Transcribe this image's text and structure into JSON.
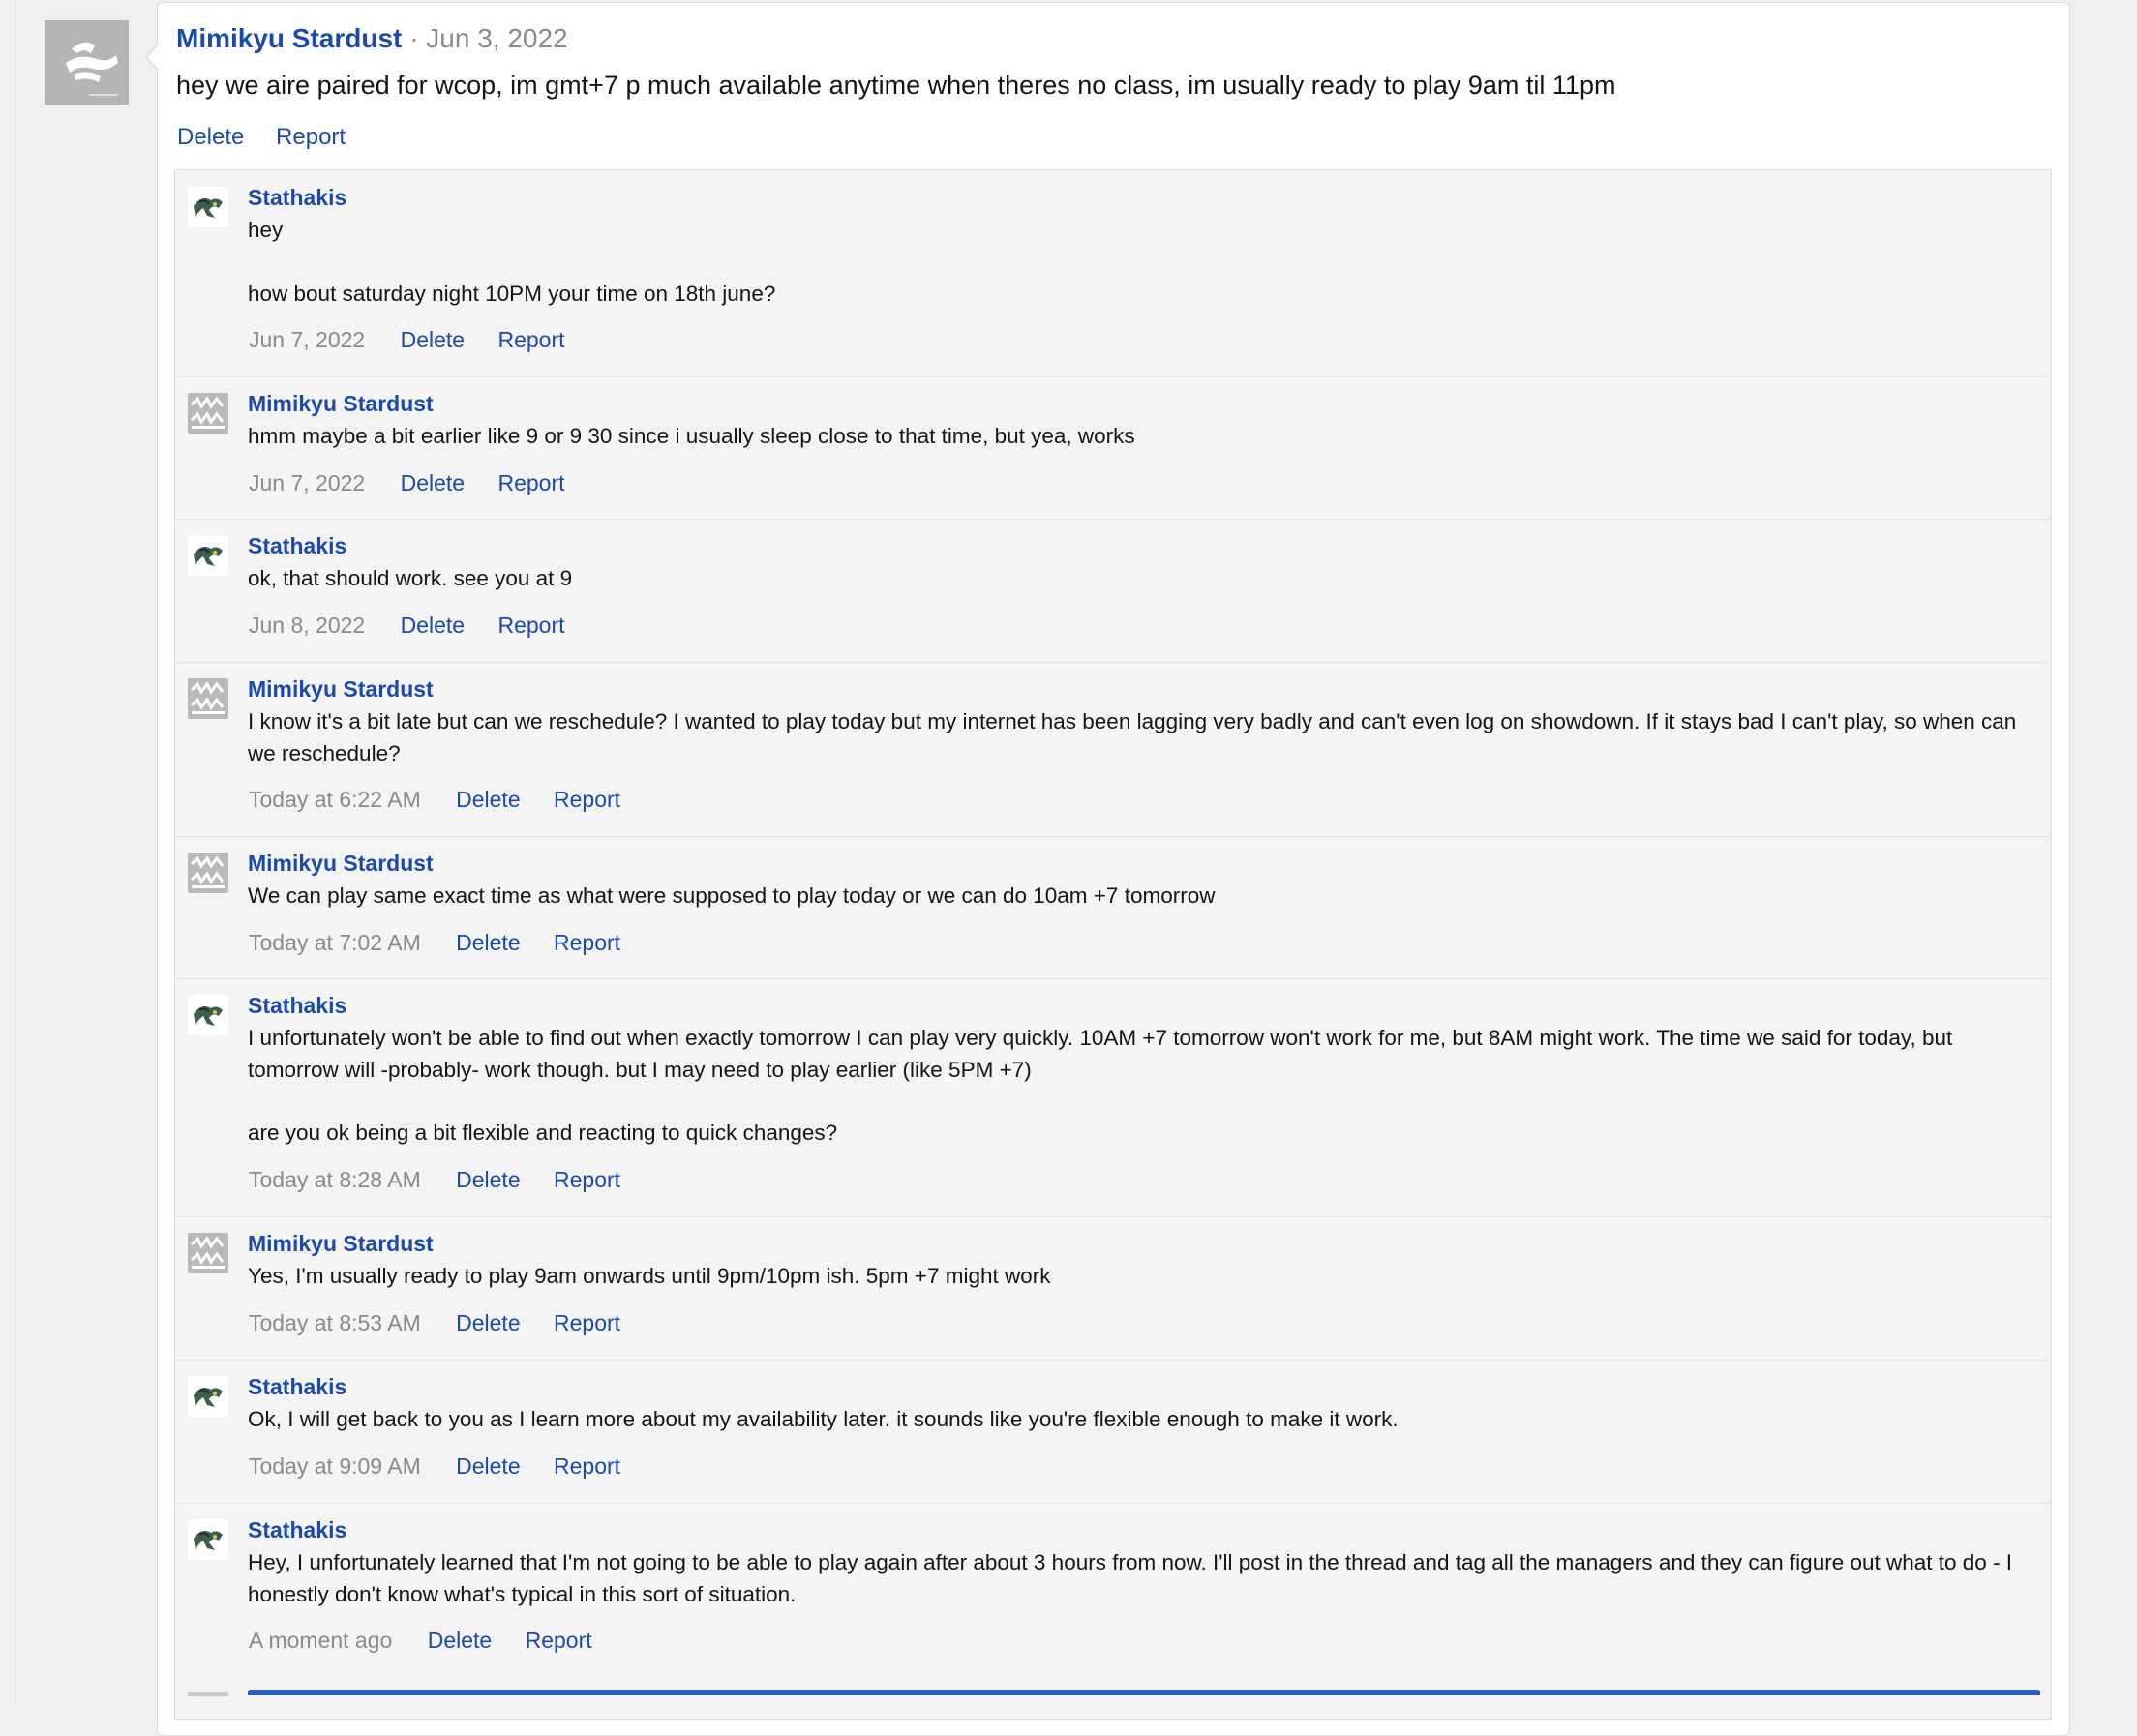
{
  "profile_post": {
    "author": "Mimikyu Stardust",
    "separator": "·",
    "date": "Jun 3, 2022",
    "text": "hey we aire paired for wcop, im gmt+7 p much available anytime when theres no class, im usually ready to play 9am til 11pm",
    "delete_label": "Delete",
    "report_label": "Report"
  },
  "replies": [
    {
      "author": "Stathakis",
      "avatar": "stathakis-avatar",
      "text": [
        "hey",
        "how bout saturday night 10PM your time on 18th june?"
      ],
      "date": "Jun 7, 2022",
      "delete_label": "Delete",
      "report_label": "Report"
    },
    {
      "author": "Mimikyu Stardust",
      "avatar": "mimikyu-avatar",
      "text": [
        "hmm maybe a bit earlier like 9 or 9 30 since i usually sleep close to that time, but yea, works"
      ],
      "date": "Jun 7, 2022",
      "delete_label": "Delete",
      "report_label": "Report"
    },
    {
      "author": "Stathakis",
      "avatar": "stathakis-avatar",
      "text": [
        "ok, that should work. see you at 9"
      ],
      "date": "Jun 8, 2022",
      "delete_label": "Delete",
      "report_label": "Report"
    },
    {
      "author": "Mimikyu Stardust",
      "avatar": "mimikyu-avatar",
      "text": [
        "I know it's a bit late but can we reschedule? I wanted to play today but my internet has been lagging very badly and can't even log on showdown. If it stays bad I can't play, so when can we reschedule?"
      ],
      "date": "Today at 6:22 AM",
      "delete_label": "Delete",
      "report_label": "Report"
    },
    {
      "author": "Mimikyu Stardust",
      "avatar": "mimikyu-avatar",
      "text": [
        "We can play same exact time as what were supposed to play today or we can do 10am +7 tomorrow"
      ],
      "date": "Today at 7:02 AM",
      "delete_label": "Delete",
      "report_label": "Report"
    },
    {
      "author": "Stathakis",
      "avatar": "stathakis-avatar",
      "text": [
        "I unfortunately won't be able to find out when exactly tomorrow I can play very quickly. 10AM +7 tomorrow won't work for me, but 8AM might work. The time we said for today, but tomorrow will -probably- work though. but I may need to play earlier (like 5PM +7)",
        "are you ok being a bit flexible and reacting to quick changes?"
      ],
      "date": "Today at 8:28 AM",
      "delete_label": "Delete",
      "report_label": "Report"
    },
    {
      "author": "Mimikyu Stardust",
      "avatar": "mimikyu-avatar",
      "text": [
        "Yes, I'm usually ready to play 9am onwards until 9pm/10pm ish. 5pm +7 might work"
      ],
      "date": "Today at 8:53 AM",
      "delete_label": "Delete",
      "report_label": "Report"
    },
    {
      "author": "Stathakis",
      "avatar": "stathakis-avatar",
      "text": [
        "Ok, I will get back to you as I learn more about my availability later. it sounds like you're flexible enough to make it work."
      ],
      "date": "Today at 9:09 AM",
      "delete_label": "Delete",
      "report_label": "Report"
    },
    {
      "author": "Stathakis",
      "avatar": "stathakis-avatar",
      "text": [
        "Hey, I unfortunately learned that I'm not going to be able to play again after about 3 hours from now. I'll post in the thread and tag all the managers and they can figure out what to do - I honestly don't know what's typical in this sort of situation."
      ],
      "date": "A moment ago",
      "delete_label": "Delete",
      "report_label": "Report"
    }
  ],
  "colors": {
    "link": "#1c4aa8",
    "muted": "#8a8a8a",
    "thread_bg": "#f4f4f4",
    "accent_bar": "#2a5db8"
  }
}
